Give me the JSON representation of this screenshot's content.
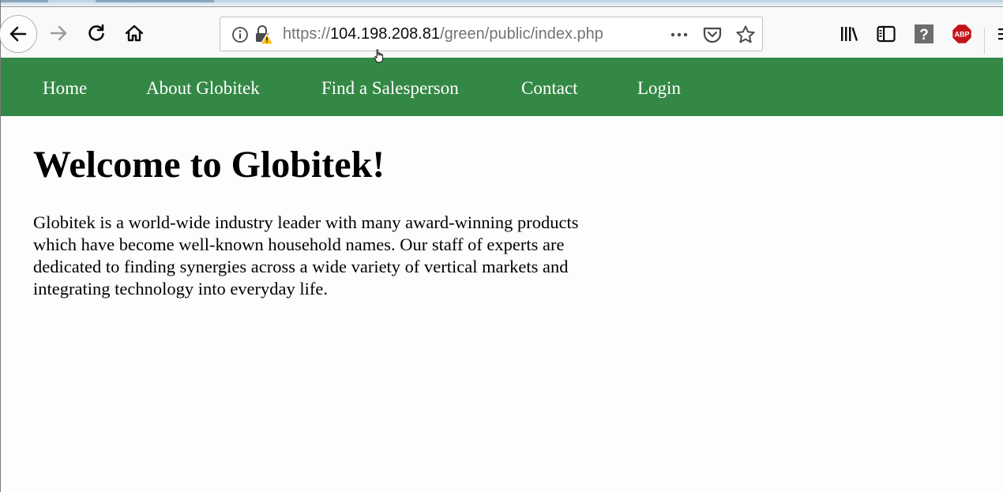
{
  "browser": {
    "url_prefix": "https://",
    "url_host": "104.198.208.81",
    "url_path": "/green/public/index.php",
    "buttons": {
      "back": "back-arrow-icon",
      "forward": "forward-arrow-icon",
      "reload": "reload-icon",
      "home": "home-icon",
      "page_actions": "more-dots-icon",
      "pocket": "pocket-icon",
      "bookmark": "star-icon",
      "library": "library-icon",
      "sidebar": "sidebar-icon",
      "help": "help-icon",
      "adblock": "ABP"
    }
  },
  "site": {
    "nav": [
      {
        "label": "Home"
      },
      {
        "label": "About Globitek"
      },
      {
        "label": "Find a Salesperson"
      },
      {
        "label": "Contact"
      },
      {
        "label": "Login"
      }
    ],
    "heading": "Welcome to Globitek!",
    "intro": "Globitek is a world-wide industry leader with many award-winning products which have become well-known household names. Our staff of experts are dedicated to finding synergies across a wide variety of vertical markets and integrating technology into everyday life."
  },
  "colors": {
    "nav_background": "#348845",
    "nav_text": "#ffffff",
    "page_background": "#fdfdfd",
    "adblock_red": "#c4141b"
  }
}
